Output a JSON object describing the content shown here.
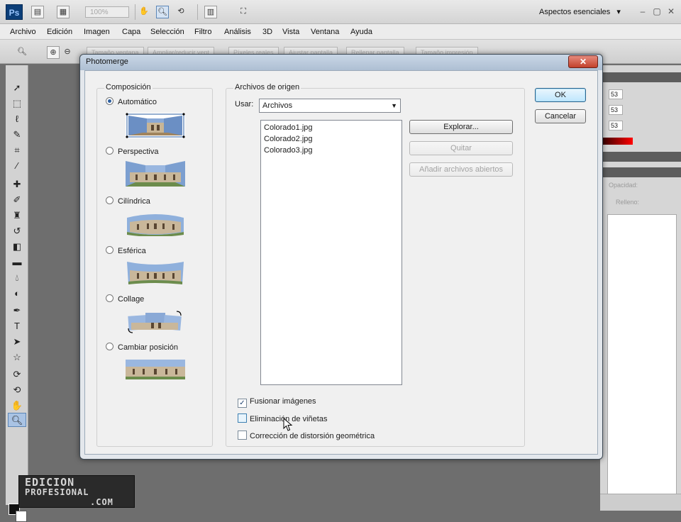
{
  "app": {
    "logo_text": "Ps",
    "zoom_value": "100%",
    "workspace_label": "Aspectos esenciales",
    "workspace_arrow": "▾",
    "window_controls": [
      "–",
      "▢",
      "✕"
    ]
  },
  "menu": [
    "Archivo",
    "Edición",
    "Imagen",
    "Capa",
    "Selección",
    "Filtro",
    "Análisis",
    "3D",
    "Vista",
    "Ventana",
    "Ayuda"
  ],
  "options_bar": {
    "buttons": [
      "Tamaño ventana",
      "Ampliar/reducir vent",
      "Píxeles reales",
      "Ajustar pantalla",
      "Rellenar pantalla",
      "Tamaño impresión"
    ]
  },
  "right_panel": {
    "fields": [
      "53",
      "53",
      "53"
    ],
    "labels": [
      "Opacidad:",
      "Relleno:"
    ]
  },
  "watermark": {
    "line1": "EDICION",
    "line2": "PROFESIONAL",
    "line3": ".COM"
  },
  "dialog": {
    "title": "Photomerge",
    "close_glyph": "✕",
    "composition": {
      "legend": "Composición",
      "options": [
        {
          "label": "Automático",
          "selected": true
        },
        {
          "label": "Perspectiva",
          "selected": false
        },
        {
          "label": "Cilíndrica",
          "selected": false
        },
        {
          "label": "Esférica",
          "selected": false
        },
        {
          "label": "Collage",
          "selected": false
        },
        {
          "label": "Cambiar posición",
          "selected": false
        }
      ]
    },
    "source": {
      "legend": "Archivos de origen",
      "use_label": "Usar:",
      "use_value": "Archivos",
      "files": [
        "Colorado1.jpg",
        "Colorado2.jpg",
        "Colorado3.jpg"
      ],
      "browse_button": "Explorar...",
      "remove_button": "Quitar",
      "add_open_button": "Añadir archivos abiertos"
    },
    "options": [
      {
        "label": "Fusionar imágenes",
        "checked": true
      },
      {
        "label": "Eliminación de viñetas",
        "checked": false
      },
      {
        "label": "Corrección de distorsión geométrica",
        "checked": false
      }
    ],
    "ok_button": "OK",
    "cancel_button": "Cancelar"
  },
  "colors": {
    "dialog_accent": "#2d5fa0",
    "photoshop_blue": "#0c3e78",
    "close_red": "#c2402b"
  }
}
